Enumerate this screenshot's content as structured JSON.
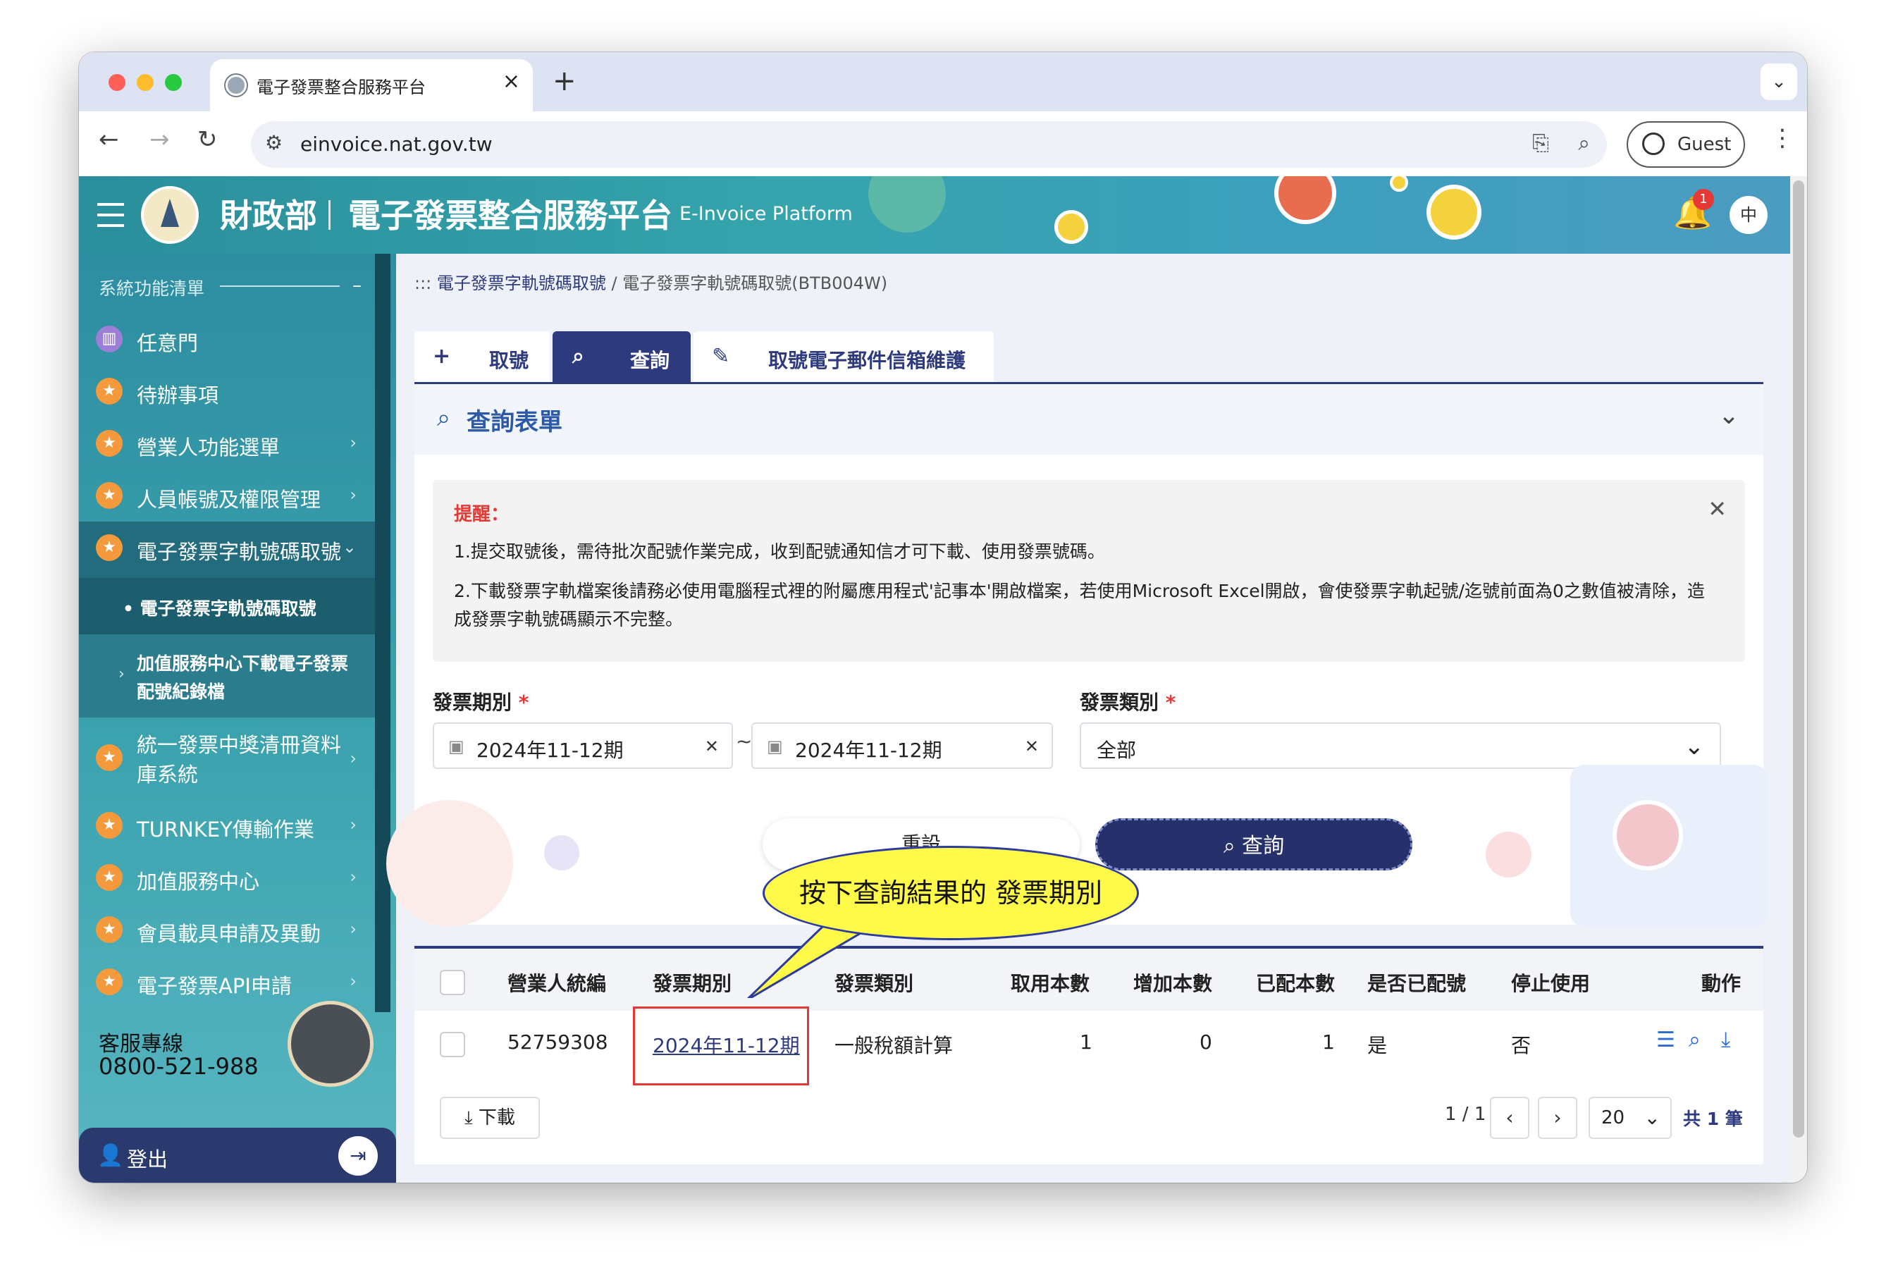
{
  "browser": {
    "tab_title": "電子發票整合服務平台",
    "tab_close": "×",
    "new_tab": "+",
    "tab_menu": "⌄",
    "url": "einvoice.nat.gov.tw",
    "profile_label": "Guest",
    "back": "←",
    "forward": "→",
    "reload": "↻",
    "kebab": "⋮"
  },
  "header": {
    "org": "財政部",
    "platform": "電子發票整合服務平台",
    "platform_en": "E-Invoice Platform",
    "notification_count": "1",
    "lang_label": "中"
  },
  "sidebar": {
    "title": "系統功能清單",
    "collapse": "–",
    "items": [
      {
        "label": "任意門",
        "icon": "map-icon"
      },
      {
        "label": "待辦事項",
        "icon": "star-icon"
      },
      {
        "label": "營業人功能選單",
        "icon": "star-icon"
      },
      {
        "label": "人員帳號及權限管理",
        "icon": "star-icon"
      },
      {
        "label": "電子發票字軌號碼取號",
        "icon": "star-icon"
      },
      {
        "label": "統一發票中獎清冊資料庫系統",
        "icon": "star-icon"
      },
      {
        "label": "TURNKEY傳輸作業",
        "icon": "star-icon"
      },
      {
        "label": "加值服務中心",
        "icon": "star-icon"
      },
      {
        "label": "會員載具申請及異動",
        "icon": "star-icon"
      },
      {
        "label": "電子發票API申請",
        "icon": "star-icon"
      }
    ],
    "sub_items": [
      "• 電子發票字軌號碼取號",
      "加值服務中心下載電子發票配號紀錄檔"
    ],
    "hotline_label": "客服專線",
    "hotline_number": "0800-521-988",
    "logout_label": "登出"
  },
  "breadcrumb": {
    "prefix": ":::",
    "parent": "電子發票字軌號碼取號",
    "sep": "/",
    "current": "電子發票字軌號碼取號(BTB004W)"
  },
  "tabs": [
    {
      "icon": "+",
      "label": "取號"
    },
    {
      "icon": "⌕",
      "label": "查詢"
    },
    {
      "icon": "✎",
      "label": "取號電子郵件信箱維護"
    }
  ],
  "form": {
    "title": "查詢表單",
    "alert_title": "提醒：",
    "alert_line1": "1.提交取號後，需待批次配號作業完成，收到配號通知信才可下載、使用發票號碼。",
    "alert_line2": "2.下載發票字軌檔案後請務必使用電腦程式裡的附屬應用程式'記事本'開啟檔案，若使用Microsoft Excel開啟，會使發票字軌起號/迄號前面為0之數值被清除，造成發票字軌號碼顯示不完整。",
    "period_label": "發票期別",
    "period_from": "2024年11-12期",
    "period_to": "2024年11-12期",
    "period_sep": "~",
    "type_label": "發票類別",
    "type_value": "全部",
    "reset_label": "重設",
    "query_label": "查詢"
  },
  "table": {
    "headers": [
      "營業人統編",
      "發票期別",
      "發票類別",
      "取用本數",
      "增加本數",
      "已配本數",
      "是否已配號",
      "停止使用",
      "動作"
    ],
    "rows": [
      [
        "52759308",
        "2024年11-12期",
        "一般稅額計算",
        "1",
        "0",
        "1",
        "是",
        "否"
      ]
    ],
    "download_label": "下載",
    "page_info": "1 / 1",
    "page_size": "20",
    "total": "共 1 筆"
  },
  "annotation": {
    "text": "按下查詢結果的 發票期別"
  }
}
